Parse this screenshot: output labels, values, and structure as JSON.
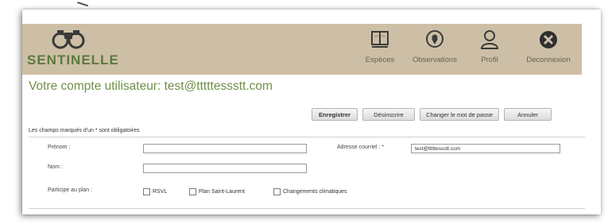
{
  "brand": {
    "name": "SENTINELLE",
    "accent": "#6f8f48",
    "header_bg": "#cdbfa6"
  },
  "nav": [
    {
      "label": "Espèces",
      "icon": "book-icon"
    },
    {
      "label": "Observations",
      "icon": "map-pin-icon"
    },
    {
      "label": "Profil",
      "icon": "user-icon"
    },
    {
      "label": "Deconnexion",
      "icon": "close-circle-icon"
    }
  ],
  "page": {
    "title": "Votre compte utilisateur: test@tttttessstt.com"
  },
  "actions": {
    "save": "Enregistrer",
    "unsubscribe": "Désinscrire",
    "change_password": "Changer le mot de passe",
    "cancel": "Annuler"
  },
  "form": {
    "required_note": "Les champs marqués d'un * sont obligatoires",
    "first_name": {
      "label": "Prénom :",
      "value": ""
    },
    "last_name": {
      "label": "Nom :",
      "value": ""
    },
    "email": {
      "label": "Adresse courriel : *",
      "value": "test@tttttessstt.com"
    },
    "plan": {
      "label": "Participe au plan :",
      "options": [
        {
          "label": "RSVL",
          "checked": false
        },
        {
          "label": "Plan Saint-Laurent",
          "checked": false
        },
        {
          "label": "Changements climatiques",
          "checked": false
        }
      ]
    }
  }
}
